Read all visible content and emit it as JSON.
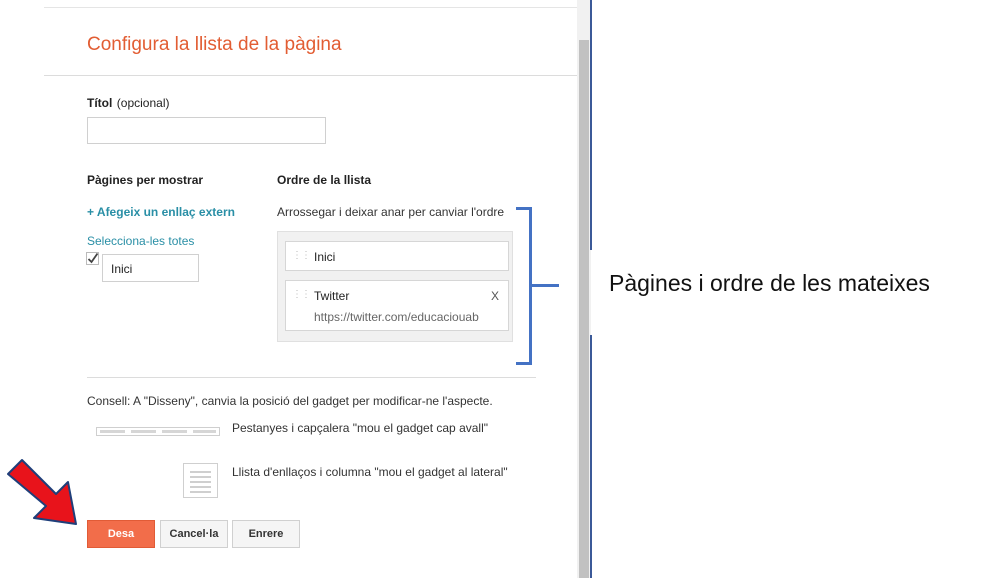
{
  "dialog": {
    "title": "Configura la llista de la pàgina",
    "title_field": {
      "label": "Títol",
      "label_hint": "(opcional)",
      "value": ""
    },
    "pages_section": {
      "heading": "Pàgines per mostrar",
      "add_external_link": "+ Afegeix un enllaç extern",
      "select_all": "Selecciona-les totes",
      "pages": [
        {
          "label": "Inici",
          "checked": true
        }
      ]
    },
    "order_section": {
      "heading": "Ordre de la llista",
      "hint": "Arrossegar i deixar anar per canviar l'ordre",
      "items": [
        {
          "label": "Inici",
          "url": "",
          "removable": false
        },
        {
          "label": "Twitter",
          "url": "https://twitter.com/educaciouab",
          "removable": true,
          "remove_label": "X"
        }
      ]
    },
    "tip": {
      "text": "Consell: A \"Disseny\", canvia la posició del gadget per modificar-ne l'aspecte.",
      "tabs_hint": "Pestanyes i capçalera \"mou el gadget cap avall\"",
      "list_hint": "Llista d'enllaços i columna \"mou el gadget al lateral\""
    },
    "buttons": {
      "save": "Desa",
      "cancel": "Cancel·la",
      "back": "Enrere"
    }
  },
  "annotation": {
    "text": "Pàgines i ordre de les mateixes",
    "arrow_color": "#e8131b",
    "bracket_color": "#4472c4"
  },
  "colors": {
    "accent": "#e25d33",
    "link": "#2a8fa6",
    "save_button": "#f26d4a"
  }
}
